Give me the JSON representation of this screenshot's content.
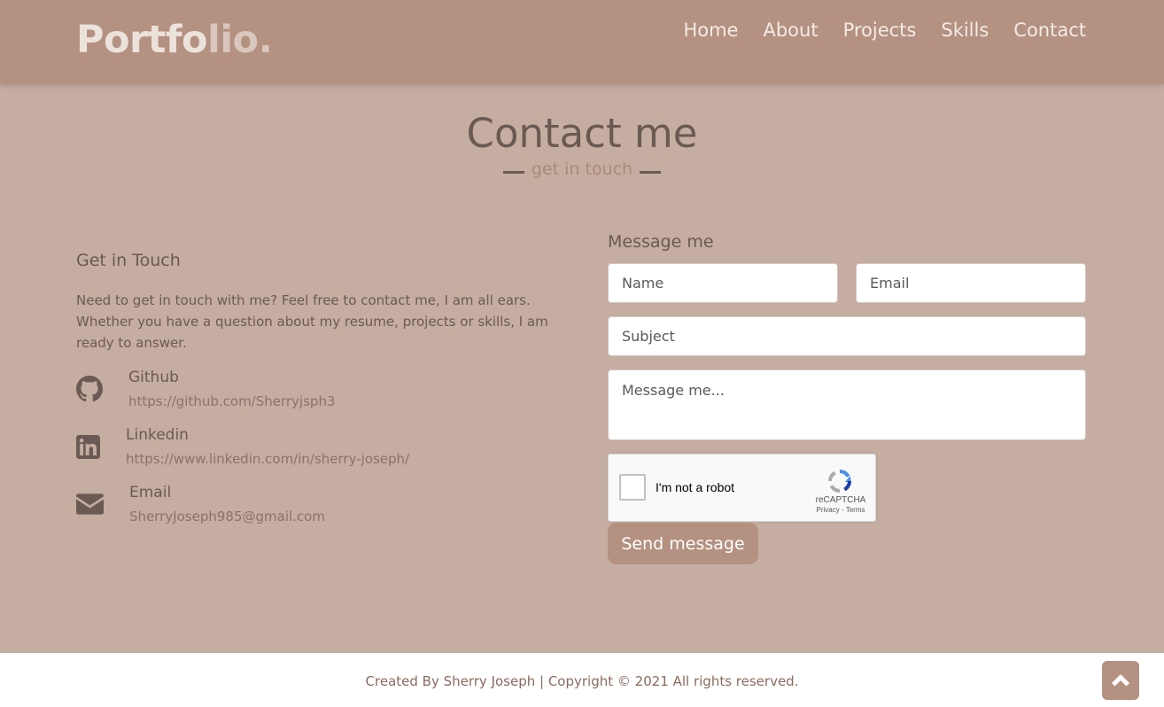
{
  "navbar": {
    "logo_part1": "Portfo",
    "logo_part2": "lio.",
    "items": [
      "Home",
      "About",
      "Projects",
      "Skills",
      "Contact"
    ]
  },
  "section": {
    "title": "Contact me",
    "subtitle": "get in touch"
  },
  "get_in_touch": {
    "heading": "Get in Touch",
    "description": "Need to get in touch with me? Feel free to contact me, I am all ears. Whether you have a question about my resume, projects or skills, I am ready to answer.",
    "contacts": [
      {
        "icon": "github-icon",
        "label": "Github",
        "value": "https://github.com/Sherryjsph3"
      },
      {
        "icon": "linkedin-icon",
        "label": "Linkedin",
        "value": "https://www.linkedin.com/in/sherry-joseph/"
      },
      {
        "icon": "envelope-icon",
        "label": "Email",
        "value": "SherryJoseph985@gmail.com"
      }
    ]
  },
  "form": {
    "heading": "Message me",
    "name_placeholder": "Name",
    "email_placeholder": "Email",
    "subject_placeholder": "Subject",
    "message_placeholder": "Message me...",
    "captcha_label": "I'm not a robot",
    "captcha_brand": "reCAPTCHA",
    "captcha_terms": "Privacy - Terms",
    "send_label": "Send message"
  },
  "footer": {
    "text": "Created By Sherry Joseph | Copyright © 2021 All rights reserved."
  },
  "colors": {
    "background": "#c5ada1",
    "navbar": "#b49180",
    "accent": "#b49180",
    "text": "#6b5a53"
  }
}
